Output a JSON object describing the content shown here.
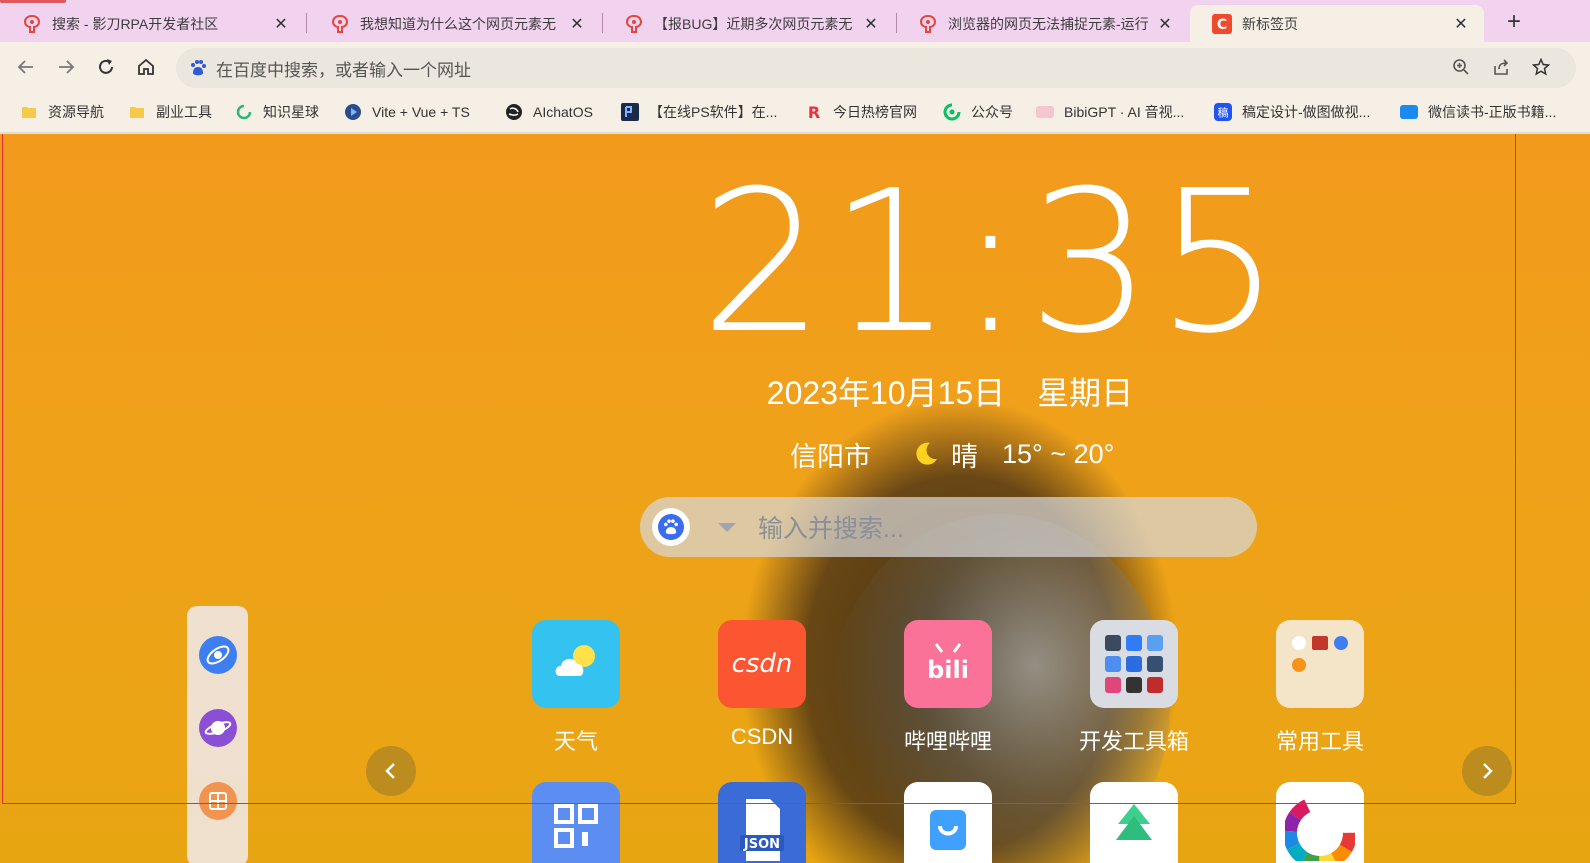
{
  "tabs": [
    {
      "title": "搜索 - 影刀RPA开发者社区",
      "active": false
    },
    {
      "title": "我想知道为什么这个网页元素无",
      "active": false
    },
    {
      "title": "【报BUG】近期多次网页元素无",
      "active": false
    },
    {
      "title": "浏览器的网页无法捕捉元素-运行",
      "active": false
    },
    {
      "title": "新标签页",
      "active": true
    }
  ],
  "omnibox": {
    "placeholder": "在百度中搜索，或者输入一个网址"
  },
  "bookmarks": [
    {
      "label": "资源导航",
      "icon": "folder-icon"
    },
    {
      "label": "副业工具",
      "icon": "folder-icon"
    },
    {
      "label": "知识星球",
      "icon": "zsxq-icon"
    },
    {
      "label": "Vite + Vue + TS",
      "icon": "vite-icon"
    },
    {
      "label": "AIchatOS",
      "icon": "aichat-icon"
    },
    {
      "label": "【在线PS软件】在...",
      "icon": "ps-icon"
    },
    {
      "label": "今日热榜官网",
      "icon": "rebang-icon"
    },
    {
      "label": "公众号",
      "icon": "wechat-mp-icon"
    },
    {
      "label": "BibiGPT · AI 音视...",
      "icon": "bibigpt-icon"
    },
    {
      "label": "稿定设计-做图做视...",
      "icon": "gaoding-icon"
    },
    {
      "label": "微信读书-正版书籍...",
      "icon": "weread-icon"
    }
  ],
  "newtab": {
    "time": "21:35",
    "date": "2023年10月15日　星期日",
    "city": "信阳市",
    "condition": "晴",
    "temp": "15° ~ 20°",
    "search_placeholder": "输入并搜索..."
  },
  "apps": [
    {
      "label": "天气",
      "color": "#34c3f0"
    },
    {
      "label": "CSDN",
      "color": "#fc5531"
    },
    {
      "label": "哔哩哔哩",
      "color": "#fb7299"
    },
    {
      "label": "开发工具箱",
      "color": "#d9dde3"
    },
    {
      "label": "常用工具",
      "color": "#f4e4c8"
    }
  ],
  "apps_row2": [
    {
      "name": "qrcode-app",
      "color": "#5b8ef0"
    },
    {
      "name": "json-app",
      "color": "#3a6bd6",
      "text": "JSON"
    },
    {
      "name": "shopping-app",
      "color": "#ffffff"
    },
    {
      "name": "tree-app",
      "color": "#ffffff"
    },
    {
      "name": "color-wheel-app",
      "color": "#ffffff"
    }
  ]
}
